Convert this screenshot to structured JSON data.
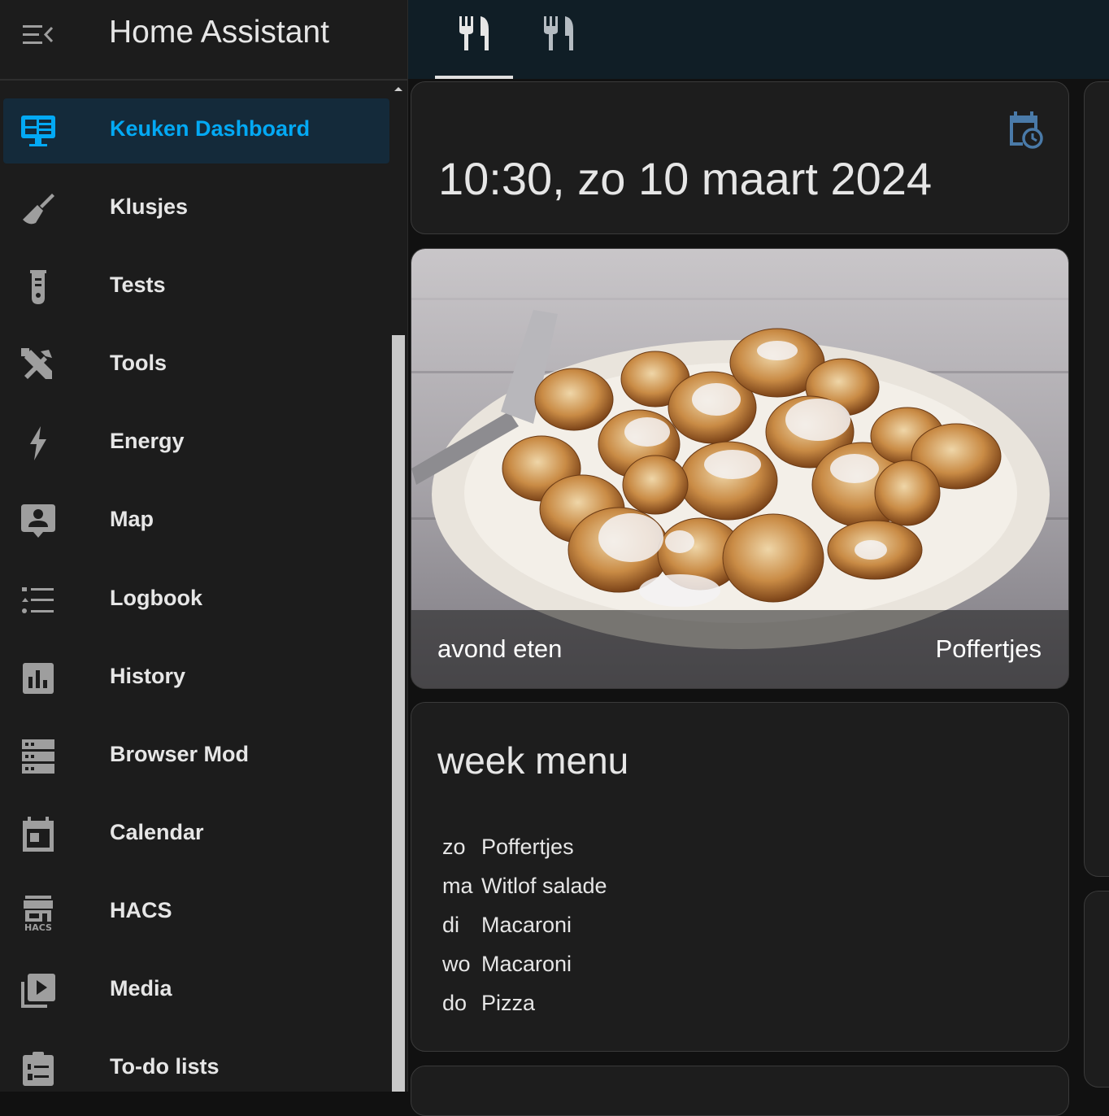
{
  "sidebar": {
    "title": "Home Assistant",
    "items": [
      {
        "label": "Keuken Dashboard",
        "icon": "monitor-dashboard-icon"
      },
      {
        "label": "Klusjes",
        "icon": "broom-icon"
      },
      {
        "label": "Tests",
        "icon": "test-tube-icon"
      },
      {
        "label": "Tools",
        "icon": "tools-icon"
      },
      {
        "label": "Energy",
        "icon": "lightning-icon"
      },
      {
        "label": "Map",
        "icon": "map-account-icon"
      },
      {
        "label": "Logbook",
        "icon": "format-list-icon"
      },
      {
        "label": "History",
        "icon": "chart-box-icon"
      },
      {
        "label": "Browser Mod",
        "icon": "server-icon"
      },
      {
        "label": "Calendar",
        "icon": "calendar-icon"
      },
      {
        "label": "HACS",
        "icon": "hacs-store-icon"
      },
      {
        "label": "Media",
        "icon": "play-box-multiple-icon"
      },
      {
        "label": "To-do lists",
        "icon": "clipboard-list-icon"
      }
    ]
  },
  "hacs_icon_text": "HACS",
  "tabs": [
    {
      "icon": "silverware-icon",
      "active": true
    },
    {
      "icon": "silverware-icon",
      "active": false
    }
  ],
  "clock": {
    "text": "10:30, zo 10 maart 2024",
    "icon": "calendar-clock-icon"
  },
  "picture_card": {
    "left_text": "avond eten",
    "right_text": "Poffertjes"
  },
  "week_menu": {
    "title": "week menu",
    "rows": [
      {
        "day": "zo",
        "dish": "Poffertjes"
      },
      {
        "day": "ma",
        "dish": "Witlof salade"
      },
      {
        "day": "di",
        "dish": "Macaroni"
      },
      {
        "day": "wo",
        "dish": "Macaroni"
      },
      {
        "day": "do",
        "dish": "Pizza"
      }
    ]
  },
  "colors": {
    "accent": "#03a9f4",
    "icon_gray": "#9e9e9e",
    "calendar_icon": "#4a7aa8"
  }
}
